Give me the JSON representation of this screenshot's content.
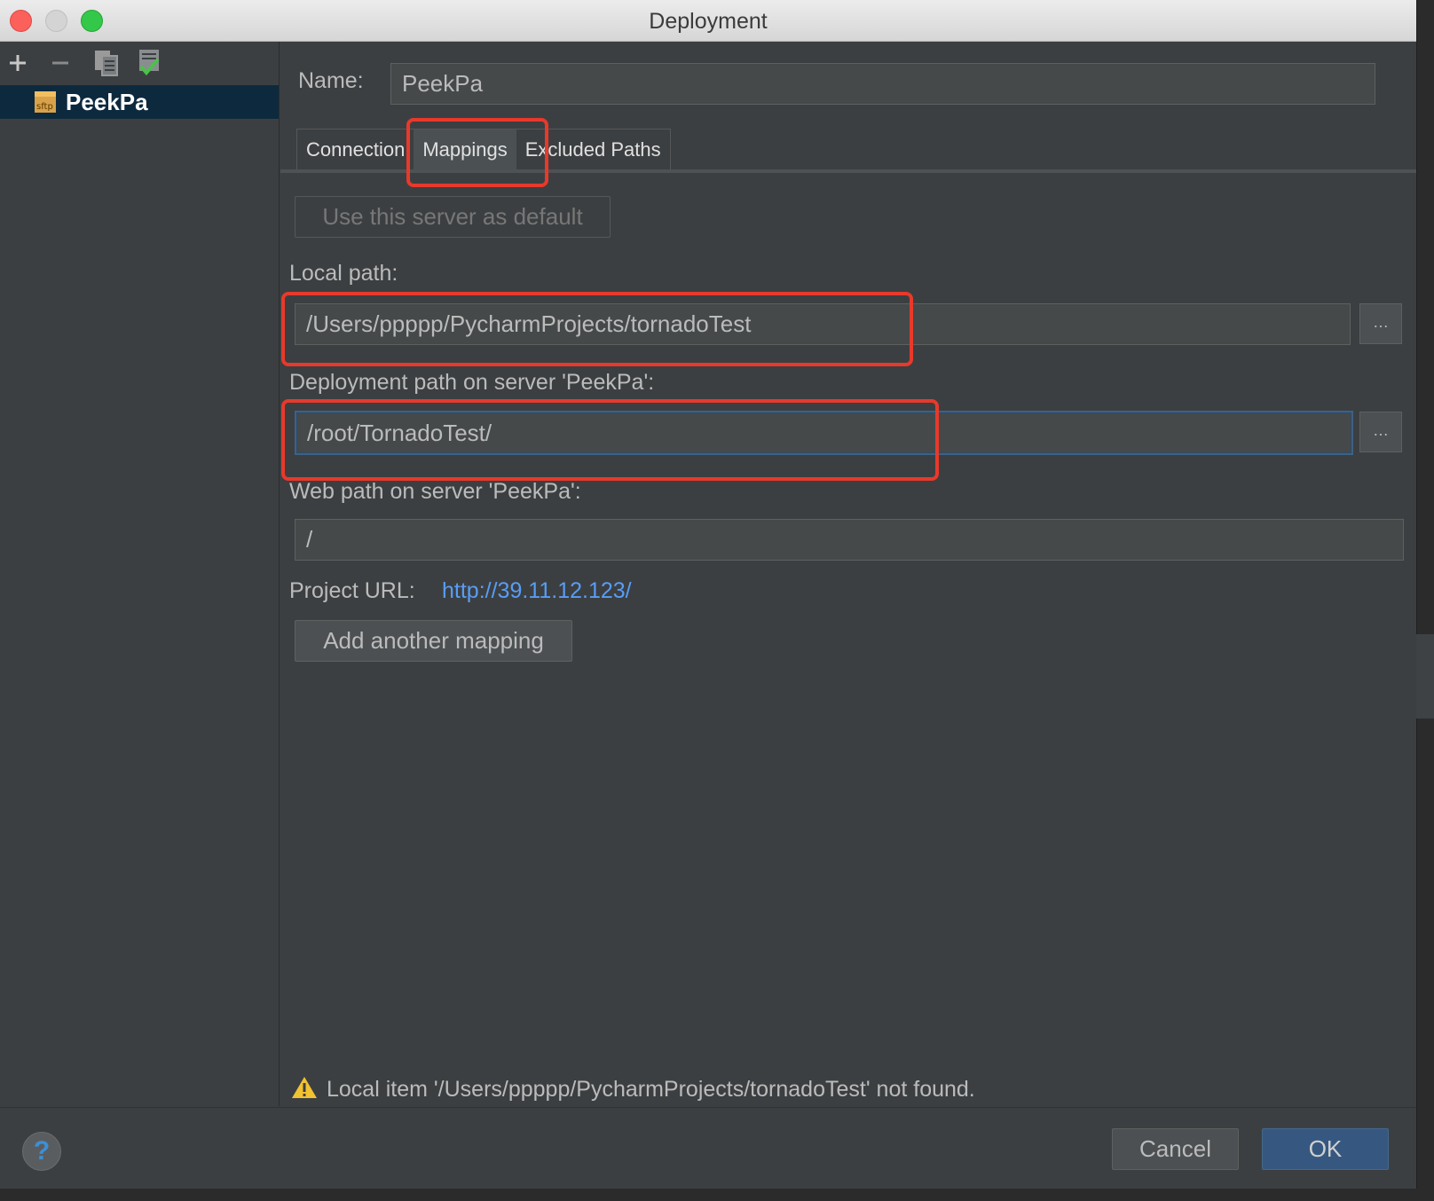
{
  "window": {
    "title": "Deployment"
  },
  "sidebar": {
    "toolbar": [
      "add-icon",
      "remove-icon",
      "copy-icon",
      "default-check-icon"
    ],
    "servers": [
      {
        "label": "PeekPa",
        "icon": "sftp-icon"
      }
    ]
  },
  "form": {
    "name_label": "Name:",
    "name_value": "PeekPa",
    "tabs": [
      {
        "label": "Connection"
      },
      {
        "label": "Mappings",
        "selected": true
      },
      {
        "label": "Excluded Paths"
      }
    ],
    "use_default_label": "Use this server as default",
    "local_path_label": "Local path:",
    "local_path_value": "/Users/ppppp/PycharmProjects/tornadoTest",
    "deployment_path_label": "Deployment path on server 'PeekPa':",
    "deployment_path_value": "/root/TornadoTest/",
    "web_path_label": "Web path on server 'PeekPa':",
    "web_path_value": "/",
    "project_url_label": "Project URL:",
    "project_url_value": "http://39.11.12.123/",
    "add_mapping_label": "Add another mapping",
    "browse_label": "…",
    "warning_text": "Local item '/Users/ppppp/PycharmProjects/tornadoTest' not found."
  },
  "footer": {
    "help_label": "?",
    "cancel_label": "Cancel",
    "ok_label": "OK"
  },
  "colors": {
    "accent": "#365880",
    "link": "#589df6",
    "highlight": "#e8392b",
    "background": "#3c3f41"
  }
}
